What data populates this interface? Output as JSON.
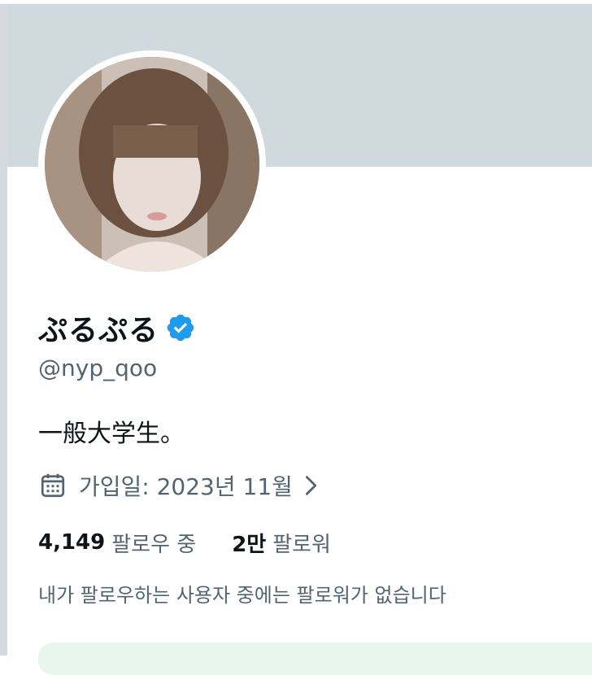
{
  "profile": {
    "display_name": "ぷるぷる",
    "handle": "@nyp_qoo",
    "bio": "一般大学生。",
    "joined": "가입일: 2023년 11월",
    "following_count": "4,149",
    "following_label": "팔로우 중",
    "followers_count": "2만",
    "followers_label": "팔로워",
    "mutual_note": "내가 팔로우하는 사용자 중에는 팔로워가 없습니다"
  },
  "colors": {
    "banner": "#cfd9de",
    "verified_badge": "#1d9bf0",
    "secondary_text": "#536471",
    "primary_text": "#0f1419"
  },
  "icons": {
    "verified": "verified-badge-icon",
    "calendar": "calendar-icon",
    "chevron": "chevron-right-icon"
  }
}
